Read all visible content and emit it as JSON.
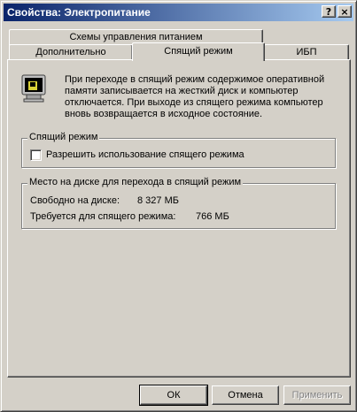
{
  "window": {
    "title": "Свойства: Электропитание"
  },
  "titlebar_buttons": {
    "help": "?",
    "close": "×"
  },
  "tabs": {
    "row1": [
      {
        "label": "Схемы управления питанием"
      }
    ],
    "row2": [
      {
        "label": "Дополнительно"
      },
      {
        "label": "Спящий режим",
        "active": true
      },
      {
        "label": "ИБП"
      }
    ]
  },
  "hibernate": {
    "icon": "hibernate-computer-icon",
    "description_lines": [
      "При переходе в спящий режим содержимое оперативной",
      "памяти записывается на жесткий диск и компьютер",
      "отключается. При выходе из спящего режима компьютер",
      "вновь возвращается в исходное состояние."
    ],
    "group_title": "Спящий режим",
    "checkbox_label": "Разрешить использование спящего режима",
    "checkbox_checked": false
  },
  "disk_space": {
    "group_title": "Место на диске для перехода в спящий режим",
    "free_label": "Свободно на диске:",
    "free_value": "8 327 МБ",
    "required_label": "Требуется для спящего режима:",
    "required_value": "766 МБ"
  },
  "buttons": {
    "ok": "ОК",
    "cancel": "Отмена",
    "apply": "Применить"
  }
}
